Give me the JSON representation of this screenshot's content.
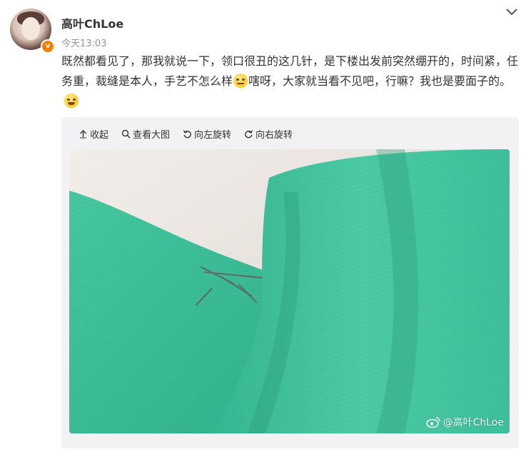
{
  "post": {
    "username": "高叶ChLoe",
    "timestamp": "今天13:03",
    "text_part1": "既然都看见了，那我就说一下，领口很丑的这几针，是下楼出发前突然绷开的，时间紧，任务重，裁缝是本人，手艺不怎么样",
    "text_part2": "嗐呀，大家就当看不见吧，行嘛？我也是要面子的。",
    "verified_badge": "v"
  },
  "media_toolbar": {
    "collapse": "收起",
    "view_large": "查看大图",
    "rotate_left": "向左旋转",
    "rotate_right": "向右旋转"
  },
  "image": {
    "watermark": "@高叶ChLoe",
    "colors": {
      "fabric": "#3fbf9a",
      "wall": "#ece8e3"
    }
  },
  "icons": [
    "chevron-down-icon",
    "up-arrow-icon",
    "magnifier-icon",
    "rotate-left-icon",
    "rotate-right-icon",
    "weibo-icon",
    "smile-emoji-icon",
    "laugh-emoji-icon"
  ]
}
